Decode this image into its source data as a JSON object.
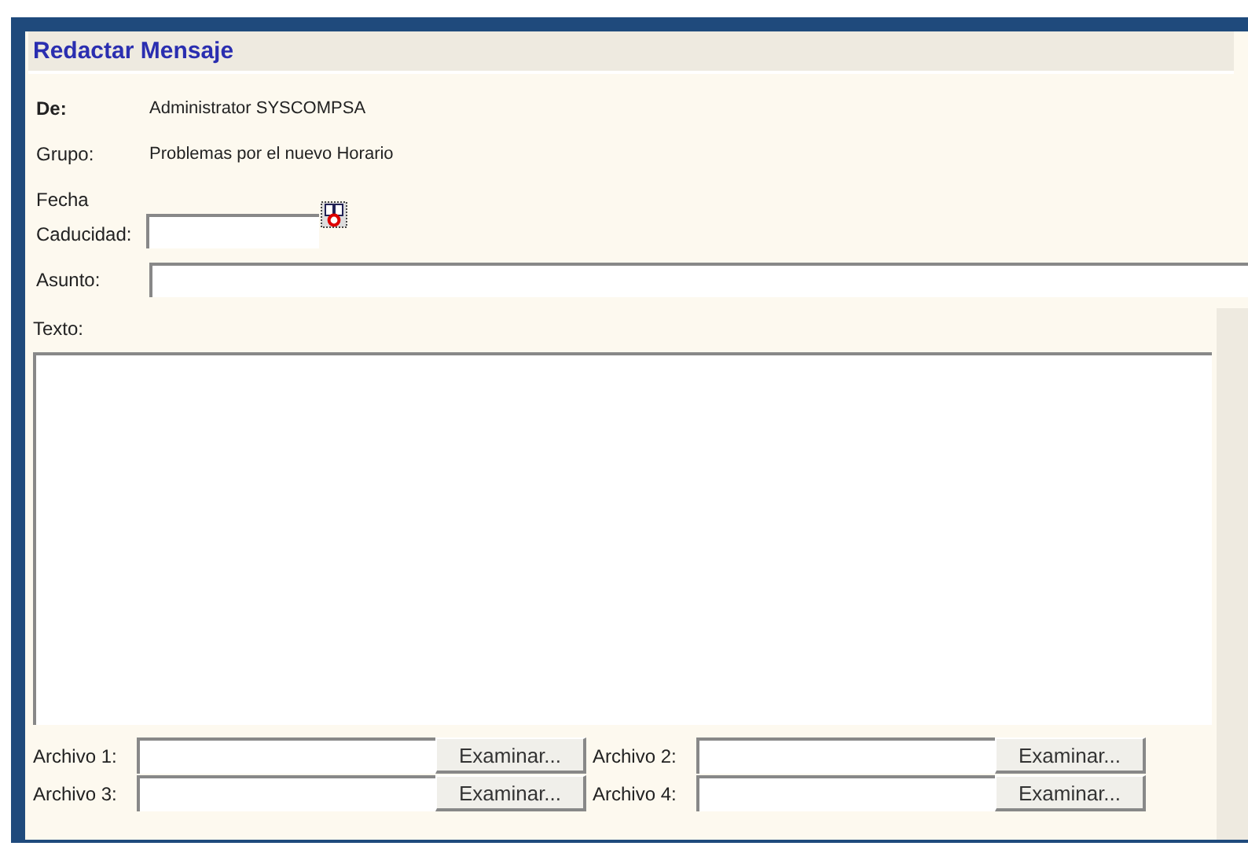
{
  "title": "Redactar Mensaje",
  "fields": [
    {
      "label": "De:",
      "value": "Administrator SYSCOMPSA",
      "bold": true
    },
    {
      "label": "Grupo:",
      "value": "Problemas por el nuevo Horario",
      "bold": false
    }
  ],
  "expiry": {
    "label_lines": [
      "Fecha",
      "Caducidad:"
    ]
  },
  "subject": {
    "label": "Asunto:"
  },
  "body": {
    "label": "Texto:"
  },
  "attachments": [
    {
      "label": "Archivo 1:",
      "button": "Examinar..."
    },
    {
      "label": "Archivo 2:",
      "button": "Examinar..."
    },
    {
      "label": "Archivo 3:",
      "button": "Examinar..."
    },
    {
      "label": "Archivo 4:",
      "button": "Examinar..."
    }
  ]
}
